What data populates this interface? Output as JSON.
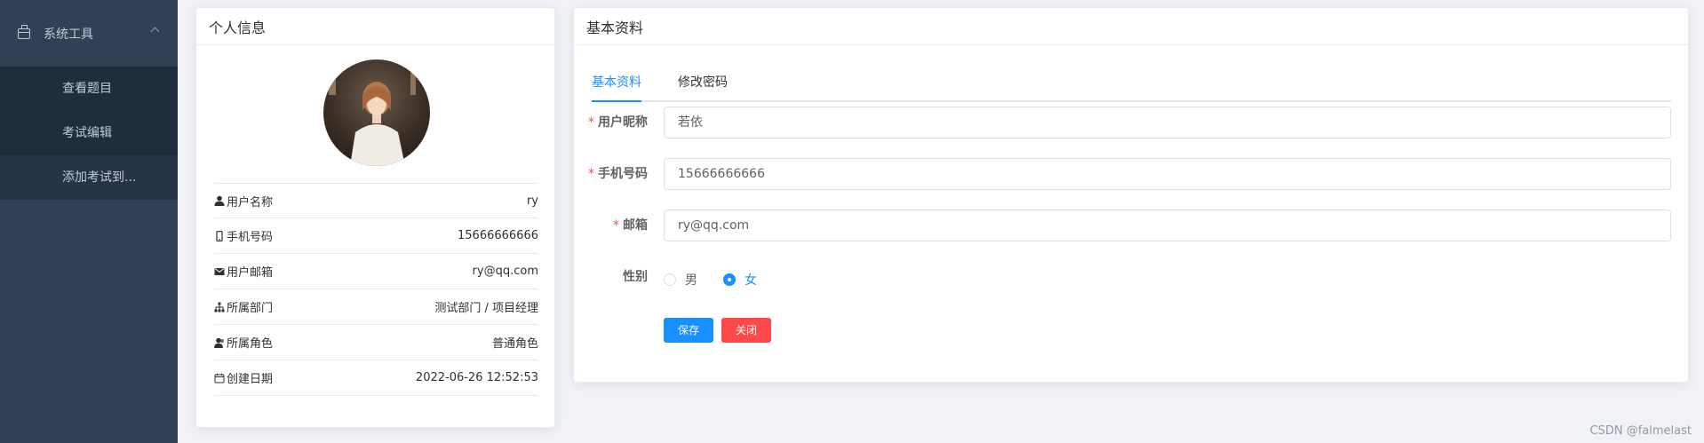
{
  "sidebar": {
    "group_label": "系统工具",
    "items": [
      {
        "label": "查看题目"
      },
      {
        "label": "考试编辑"
      },
      {
        "label": "添加考试到..."
      }
    ]
  },
  "profile_card": {
    "title": "个人信息",
    "rows": [
      {
        "icon": "user-icon",
        "label": "用户名称",
        "value": "ry"
      },
      {
        "icon": "phone-icon",
        "label": "手机号码",
        "value": "15666666666"
      },
      {
        "icon": "mail-icon",
        "label": "用户邮箱",
        "value": "ry@qq.com"
      },
      {
        "icon": "org-tree-icon",
        "label": "所属部门",
        "value": "测试部门 / 项目经理"
      },
      {
        "icon": "role-icon",
        "label": "所属角色",
        "value": "普通角色"
      },
      {
        "icon": "calendar-icon",
        "label": "创建日期",
        "value": "2022-06-26 12:52:53"
      }
    ]
  },
  "basic_card": {
    "title": "基本资料",
    "tabs": [
      {
        "label": "基本资料",
        "active": true
      },
      {
        "label": "修改密码",
        "active": false
      }
    ],
    "form": {
      "nickname": {
        "required_mark": "*",
        "label": "用户昵称",
        "value": "若依"
      },
      "phone": {
        "required_mark": "*",
        "label": "手机号码",
        "value": "15666666666"
      },
      "email": {
        "required_mark": "*",
        "label": "邮箱",
        "value": "ry@qq.com"
      },
      "gender": {
        "label": "性别",
        "options": [
          "男",
          "女"
        ],
        "selected": "女"
      }
    },
    "buttons": {
      "save": "保存",
      "close": "关闭"
    }
  },
  "watermark": "CSDN @falmelast",
  "colors": {
    "primary": "#1890ff",
    "danger": "#ff4949",
    "sidebar": "#304156"
  }
}
